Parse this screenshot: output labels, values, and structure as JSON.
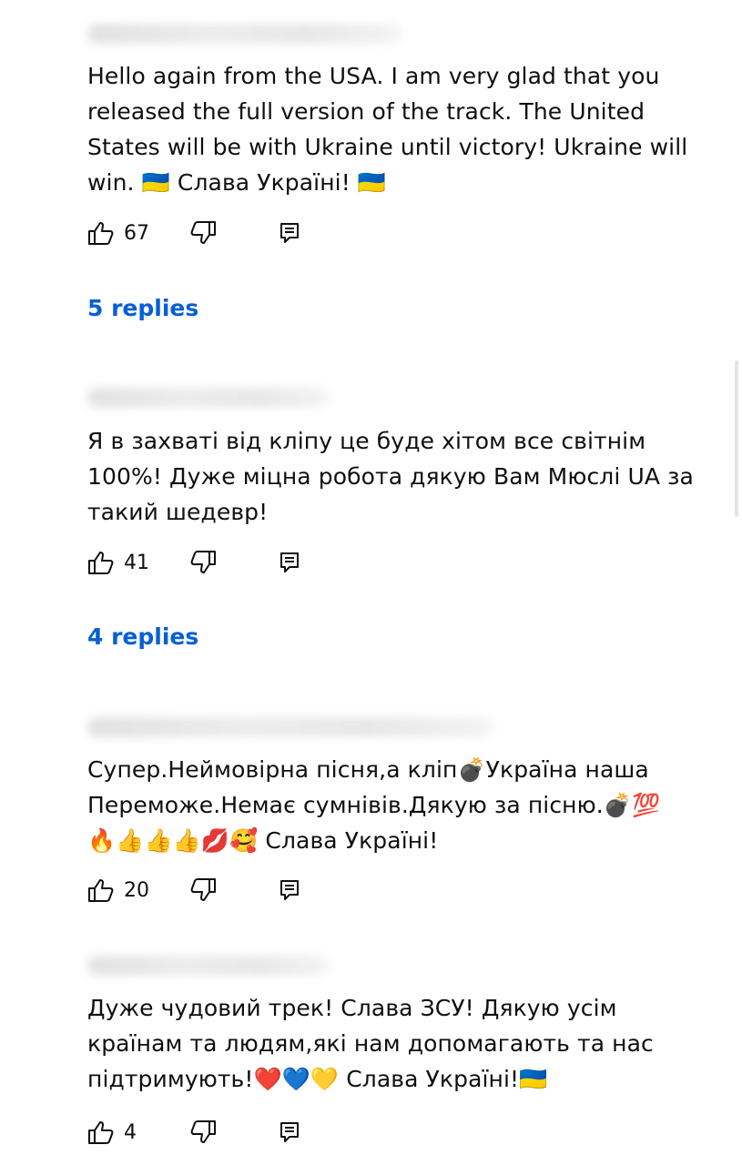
{
  "comments": [
    {
      "text": "Hello again from the USA. I am very glad that you released the full version of the track. The United States will be with Ukraine until victory! Ukraine will win. 🇺🇦 Слава Україні! 🇺🇦",
      "likes": "67",
      "replies": "5 replies"
    },
    {
      "text": "Я в захваті від кліпу це буде хітом все світнім 100%! Дуже міцна робота дякую Вам Мюслі UA за такий шедевр!",
      "likes": "41",
      "replies": "4 replies"
    },
    {
      "text": "Супер.Неймовірна пісня,а кліп💣Україна наша Переможе.Немає сумнівів.Дякую за пісню.💣💯🔥👍👍👍💋🥰 Слава Україні!",
      "likes": "20"
    },
    {
      "text": "Дуже чудовий трек! Слава ЗСУ! Дякую усім країнам та людям,які нам допомагають та нас підтримують!❤️💙💛 Слава Україні!🇺🇦",
      "likes": "4"
    }
  ],
  "icons": {
    "like": "thumb-up-icon",
    "dislike": "thumb-down-icon",
    "reply": "comment-reply-icon"
  },
  "colors": {
    "link": "#065fd4",
    "text": "#0f0f0f"
  }
}
